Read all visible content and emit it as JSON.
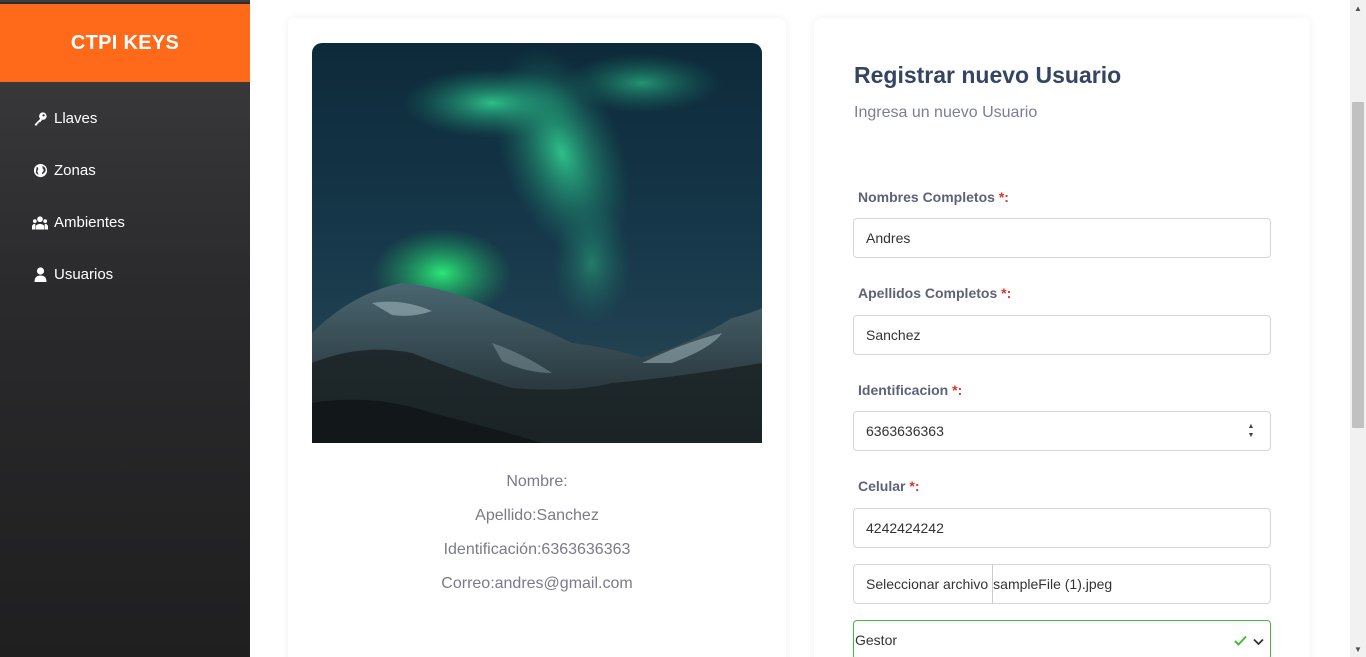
{
  "sidebar": {
    "brand": "CTPI KEYS",
    "items": [
      {
        "label": "Llaves",
        "icon": "key-icon"
      },
      {
        "label": "Zonas",
        "icon": "globe-icon"
      },
      {
        "label": "Ambientes",
        "icon": "users-group-icon"
      },
      {
        "label": "Usuarios",
        "icon": "user-icon"
      }
    ]
  },
  "preview": {
    "nombre": "Nombre:",
    "apellido": "Apellido:Sanchez",
    "identificacion": "Identificación:6363636363",
    "correo": "Correo:andres@gmail.com"
  },
  "form": {
    "title": "Registrar nuevo Usuario",
    "subtitle": "Ingresa un nuevo Usuario",
    "required_mark": "*",
    "fields": {
      "nombres": {
        "label": "Nombres Completos ",
        "colon": ":",
        "value": "Andres"
      },
      "apellidos": {
        "label": "Apellidos Completos ",
        "colon": ":",
        "value": "Sanchez"
      },
      "identificacion": {
        "label": "Identificacion ",
        "colon": ":",
        "value": "6363636363"
      },
      "celular": {
        "label": "Celular ",
        "colon": ":",
        "value": "4242424242"
      }
    },
    "file": {
      "button_label": "Seleccionar archivo",
      "file_name": "sampleFile (1).jpeg"
    },
    "rol": {
      "selected": "Gestor"
    }
  },
  "colors": {
    "brand": "#ff6a1a",
    "sidebar_bg": "#2a2a2c",
    "title": "#344563",
    "required": "#e0302b",
    "valid": "#45b83a"
  }
}
